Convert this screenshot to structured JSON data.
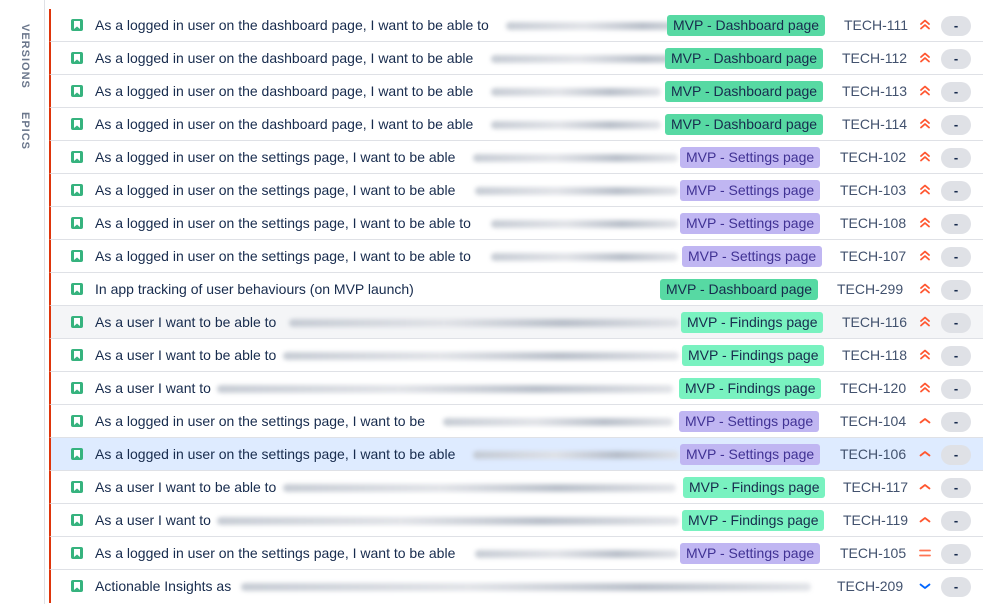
{
  "sidebar": {
    "versions_label": "VERSIONS",
    "epics_label": "EPICS"
  },
  "colors": {
    "story_icon": "#36b37e",
    "row_marker": "#de350b",
    "priority_high": "#ff5630",
    "priority_medium": "#ff7452",
    "priority_low": "#0065ff",
    "epic_dashboard": "#57d9a3",
    "epic_findings": "#79f2c0",
    "epic_settings": "#c0b6f2"
  },
  "issues": [
    {
      "summary": "As a logged in user on the dashboard page, I want to be able to",
      "epic": "MVP - Dashboard page",
      "key": "TECH-111",
      "priority": "highest-icon",
      "estimate": "-"
    },
    {
      "summary": "As a logged in user on the dashboard page, I want to be able",
      "epic": "MVP - Dashboard page",
      "key": "TECH-112",
      "priority": "highest-icon",
      "estimate": "-"
    },
    {
      "summary": "As a logged in user on the dashboard page, I want to be able",
      "epic": "MVP - Dashboard page",
      "key": "TECH-113",
      "priority": "highest-icon",
      "estimate": "-"
    },
    {
      "summary": "As a logged in user on the dashboard page, I want to be able",
      "epic": "MVP - Dashboard page",
      "key": "TECH-114",
      "priority": "highest-icon",
      "estimate": "-"
    },
    {
      "summary": "As a logged in user on the settings page, I want to be able",
      "epic": "MVP - Settings page",
      "key": "TECH-102",
      "priority": "highest-icon",
      "estimate": "-"
    },
    {
      "summary": "As a logged in user on the settings page, I want to be able",
      "epic": "MVP - Settings page",
      "key": "TECH-103",
      "priority": "highest-icon",
      "estimate": "-"
    },
    {
      "summary": "As a logged in user on the settings page, I want to be able to",
      "epic": "MVP - Settings page",
      "key": "TECH-108",
      "priority": "highest-icon",
      "estimate": "-"
    },
    {
      "summary": "As a logged in user on the settings page, I want to be able to",
      "epic": "MVP - Settings page",
      "key": "TECH-107",
      "priority": "highest-icon",
      "estimate": "-"
    },
    {
      "summary": "In app tracking of user behaviours (on MVP launch)",
      "epic": "MVP - Dashboard page",
      "key": "TECH-299",
      "priority": "highest-icon",
      "estimate": "-"
    },
    {
      "summary": "As a user I want to be able to",
      "epic": "MVP - Findings page",
      "key": "TECH-116",
      "priority": "highest-icon",
      "estimate": "-"
    },
    {
      "summary": "As a user I want to be able to",
      "epic": "MVP - Findings page",
      "key": "TECH-118",
      "priority": "highest-icon",
      "estimate": "-"
    },
    {
      "summary": "As a user I want to",
      "epic": "MVP - Findings page",
      "key": "TECH-120",
      "priority": "highest-icon",
      "estimate": "-"
    },
    {
      "summary": "As a logged in user on the settings page, I want to be",
      "epic": "MVP - Settings page",
      "key": "TECH-104",
      "priority": "high-icon",
      "estimate": "-"
    },
    {
      "summary": "As a logged in user on the settings page, I want to be able",
      "epic": "MVP - Settings page",
      "key": "TECH-106",
      "priority": "high-icon",
      "estimate": "-"
    },
    {
      "summary": "As a user I want to be able to",
      "epic": "MVP - Findings page",
      "key": "TECH-117",
      "priority": "high-icon",
      "estimate": "-"
    },
    {
      "summary": "As a user I want to",
      "epic": "MVP - Findings page",
      "key": "TECH-119",
      "priority": "high-icon",
      "estimate": "-"
    },
    {
      "summary": "As a logged in user on the settings page, I want to be able",
      "epic": "MVP - Settings page",
      "key": "TECH-105",
      "priority": "medium-icon",
      "estimate": "-"
    },
    {
      "summary": "Actionable Insights as",
      "epic": "",
      "key": "TECH-209",
      "priority": "low-icon",
      "estimate": "-"
    }
  ]
}
